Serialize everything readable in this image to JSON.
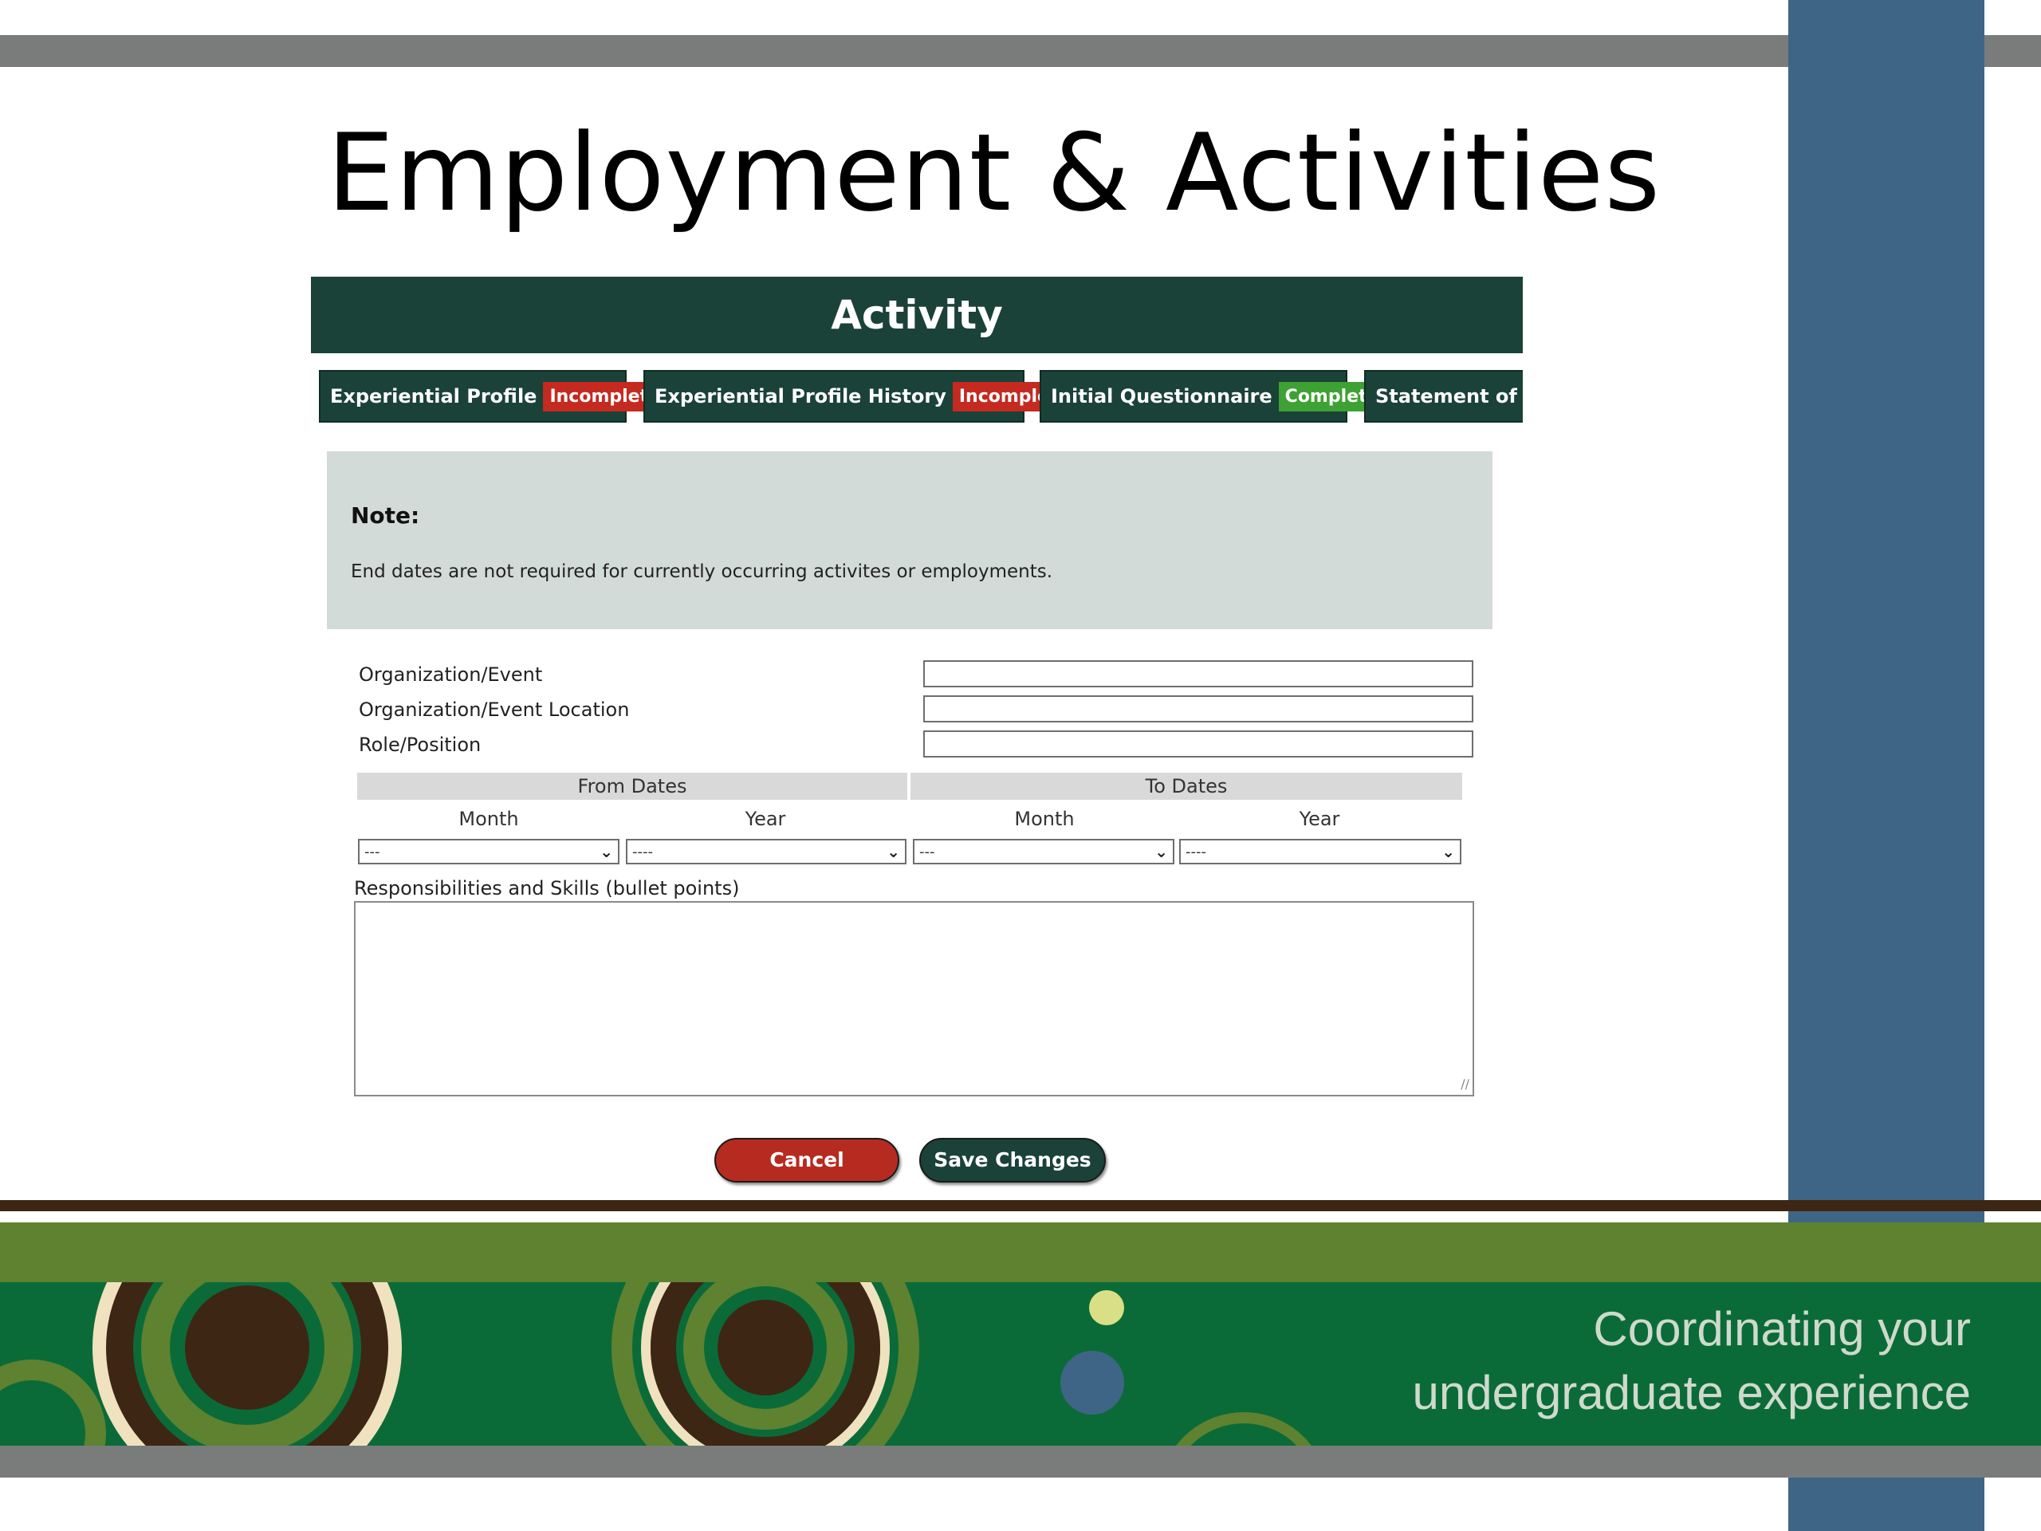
{
  "slide": {
    "title": "Employment & Activities"
  },
  "form": {
    "header": "Activity",
    "tabs": [
      {
        "label": "Experiential Profile",
        "status": "Incomplete"
      },
      {
        "label": "Experiential Profile History",
        "status": "Incomplete"
      },
      {
        "label": "Initial Questionnaire",
        "status": "Complete"
      },
      {
        "label": "Statement of Ex",
        "status": ""
      }
    ],
    "note": {
      "title": "Note:",
      "text": "End dates are not required for currently occurring activites or employments."
    },
    "fields": {
      "organization_label": "Organization/Event",
      "location_label": "Organization/Event Location",
      "role_label": "Role/Position",
      "organization_value": "",
      "location_value": "",
      "role_value": ""
    },
    "dates": {
      "from_label": "From Dates",
      "to_label": "To Dates",
      "month_label": "Month",
      "year_label": "Year",
      "from_month": "---",
      "from_year": "----",
      "to_month": "---",
      "to_year": "----"
    },
    "responsibilities_label": "Responsibilities and Skills (bullet points)",
    "cancel_label": "Cancel",
    "save_label": "Save Changes"
  },
  "banner": {
    "tagline_line1": "Coordinating your",
    "tagline_line2": "undergraduate experience"
  },
  "colors": {
    "header_green": "#1b4238",
    "incomplete_red": "#c42a20",
    "complete_green": "#3ea133",
    "cancel_red": "#b62b20",
    "side_stripe_blue": "#3e6585"
  }
}
